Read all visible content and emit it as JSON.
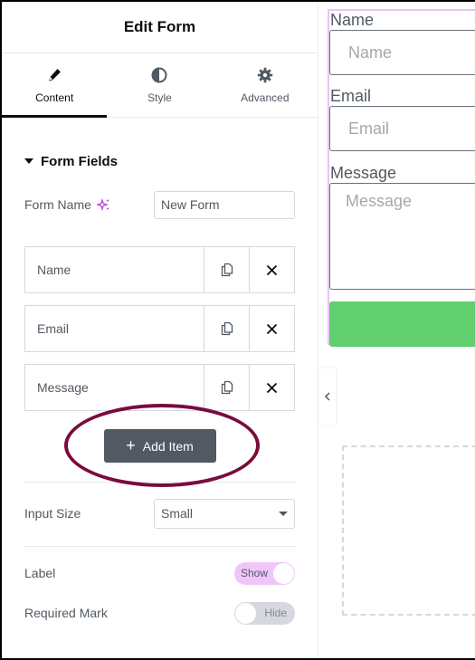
{
  "panel": {
    "title": "Edit Form",
    "tabs": [
      {
        "label": "Content",
        "icon": "pencil-icon",
        "active": true
      },
      {
        "label": "Style",
        "icon": "half-circle-icon",
        "active": false
      },
      {
        "label": "Advanced",
        "icon": "gear-icon",
        "active": false
      }
    ],
    "section_title": "Form Fields",
    "form_name": {
      "label": "Form Name",
      "value": "New Form"
    },
    "fields": [
      {
        "label": "Name"
      },
      {
        "label": "Email"
      },
      {
        "label": "Message"
      }
    ],
    "add_item_label": "Add Item",
    "add_item_icon": "+",
    "input_size": {
      "label": "Input Size",
      "value": "Small"
    },
    "label_toggle": {
      "label": "Label",
      "state": "Show"
    },
    "required_toggle": {
      "label": "Required Mark",
      "state": "Hide"
    }
  },
  "preview": {
    "fields": [
      {
        "label": "Name",
        "placeholder": "Name"
      },
      {
        "label": "Email",
        "placeholder": "Email"
      },
      {
        "label": "Message",
        "placeholder": "Message"
      }
    ]
  },
  "colors": {
    "accent_pink": "#f0c6fa",
    "annotation": "#7b0a3c",
    "submit_green": "#61ce70",
    "button_dark": "#515962"
  }
}
